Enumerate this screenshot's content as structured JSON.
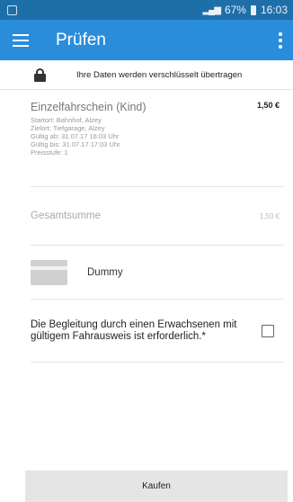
{
  "status_bar": {
    "signal": "❘❙❚",
    "battery": "67%",
    "time": "16:03"
  },
  "app_bar": {
    "title": "Prüfen"
  },
  "secure_notice": {
    "text": "Ihre Daten werden verschlüsselt übertragen"
  },
  "ticket": {
    "title": "Einzelfahrschein (Kind)",
    "price": "1,50 €",
    "details": [
      "Startort: Bahnhof, Alzey",
      "Zielort: Tiefgarage, Alzey",
      "Gültig ab: 31.07.17 16:03 Uhr",
      "Gültig bis: 31.07.17 17:03 Uhr",
      "Preisstufe: 1"
    ]
  },
  "total": {
    "label": "Gesamtsumme",
    "value": "1,50 €"
  },
  "payment": {
    "method": "Dummy"
  },
  "escort": {
    "text": "Die Begleitung durch einen Erwachsenen mit gültigem Fahrausweis ist erforderlich.*",
    "checked": false
  },
  "actions": {
    "buy_label": "Kaufen"
  },
  "colors": {
    "app_bar": "#2a8ddb",
    "status_bar": "#1e6fa8"
  }
}
